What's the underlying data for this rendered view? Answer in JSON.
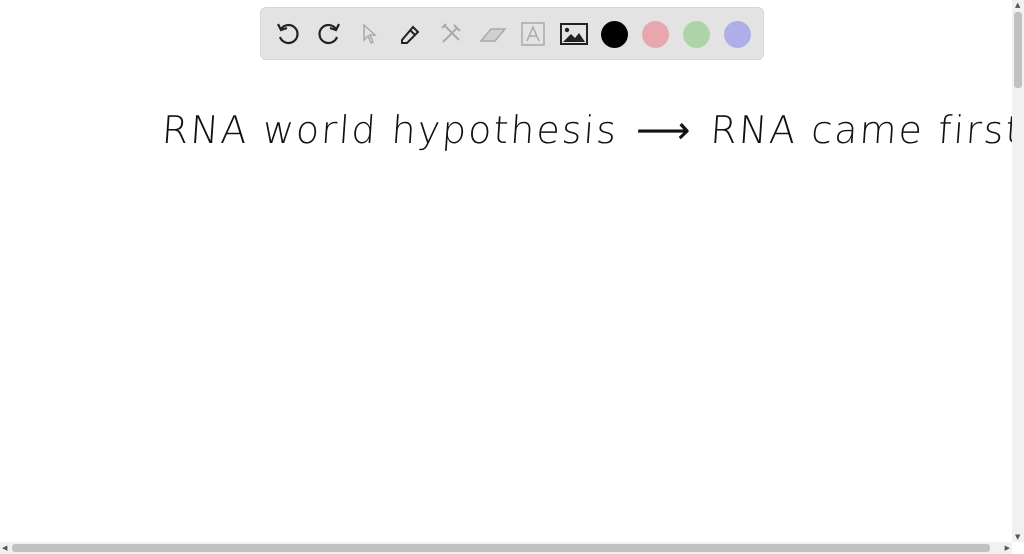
{
  "toolbar": {
    "tools": [
      "undo-icon",
      "redo-icon",
      "select-icon",
      "pen-icon",
      "tools-icon",
      "eraser-icon",
      "text-icon",
      "image-icon"
    ],
    "colors": {
      "black": "#000000",
      "pink": "#e8a6ae",
      "green": "#acd4a8",
      "purple": "#b0aee8"
    }
  },
  "canvas": {
    "left_text": "RNA world hypothesis",
    "arrow": "⟶",
    "right_text": "RNA came first"
  }
}
